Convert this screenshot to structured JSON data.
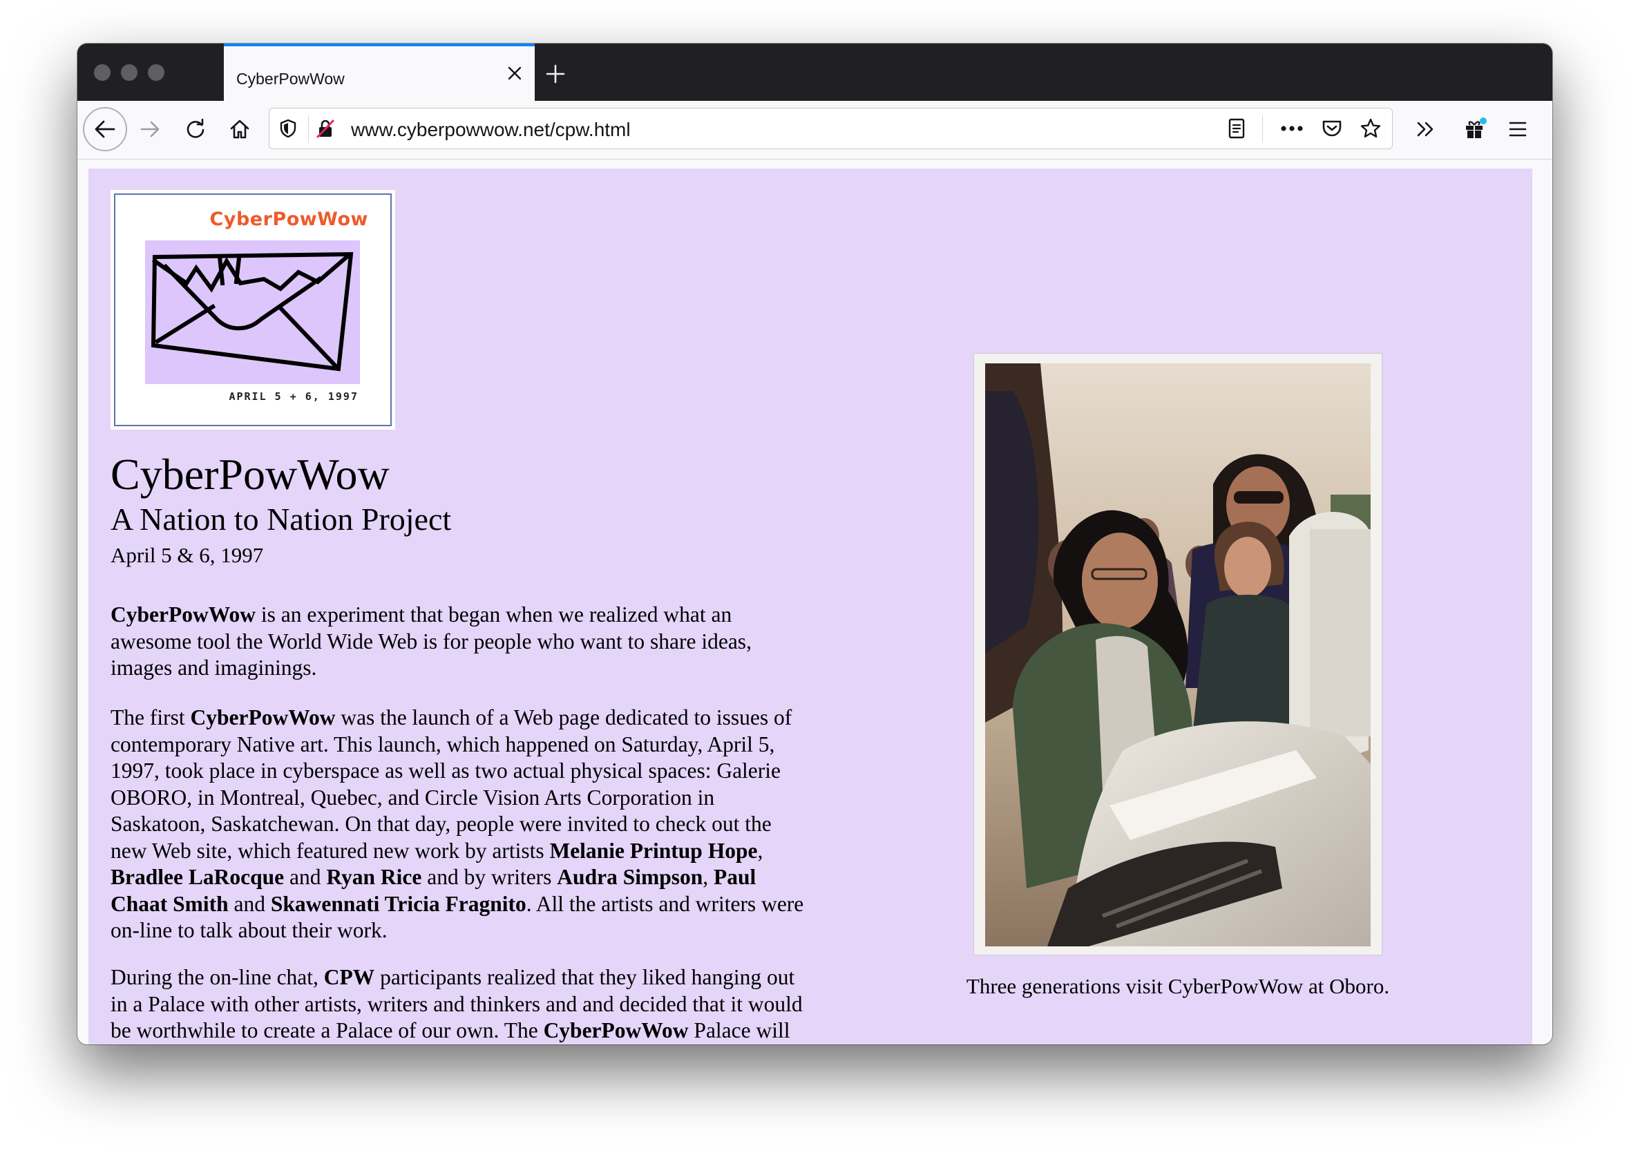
{
  "tab": {
    "title": "CyberPowWow"
  },
  "address_bar": {
    "url": "www.cyberpowwow.net/cpw.html"
  },
  "toolbar": {
    "icons": [
      "back-arrow-icon",
      "forward-arrow-icon",
      "reload-icon",
      "home-icon",
      "shield-icon",
      "insecure-lock-icon",
      "reader-view-icon",
      "more-actions-icon",
      "pocket-icon",
      "bookmark-star-icon",
      "overflow-chevron-icon",
      "gift-icon",
      "hamburger-menu-icon"
    ]
  },
  "logo": {
    "title": "CyberPowWow",
    "date": "APRIL 5 + 6, 1997"
  },
  "page": {
    "title": "CyberPowWow",
    "subtitle": "A Nation to Nation Project",
    "date": "April 5 & 6, 1997",
    "para1": {
      "b1": "CyberPowWow",
      "t1": " is an experiment that began when we realized what an awesome tool the World Wide Web is for people who want to share ideas, images and imaginings."
    },
    "para2": {
      "t1": "The first ",
      "b1": "CyberPowWow",
      "t2": " was the launch of a Web page dedicated to issues of contemporary Native art. This launch, which happened on Saturday, April 5, 1997, took place in cyberspace as well as two actual physical spaces: Galerie OBORO, in Montreal, Quebec, and Circle Vision Arts Corporation in Saskatoon, Saskatchewan. On that day, people were invited to check out the new Web site, which featured new work by artists ",
      "b2": "Melanie Printup Hope",
      "t3": ", ",
      "b3": "Bradlee LaRocque",
      "t4": " and ",
      "b4": "Ryan Rice",
      "t5": " and by writers ",
      "b5": "Audra Simpson",
      "t6": ", ",
      "b6": "Paul Chaat Smith",
      "t7": " and ",
      "b7": "Skawennati Tricia Fragnito",
      "t8": ". All the artists and writers were on-line to talk about their work."
    },
    "para3": {
      "t1": "During the on-line chat, ",
      "b1": "CPW",
      "t2": " participants realized that they liked hanging out in a Palace with other artists, writers and thinkers and and decided that it would be worthwhile to create a Palace of our own. The ",
      "b2": "CyberPowWow",
      "t3": " Palace will be an virtual gallery like no other for new nusrs and"
    },
    "photo_caption": "Three generations visit CyberPowWow at Oboro."
  },
  "colors": {
    "page_background": "#e4d5f9",
    "tab_accent": "#0a84ff",
    "logo_title": "#ef5a2a"
  }
}
